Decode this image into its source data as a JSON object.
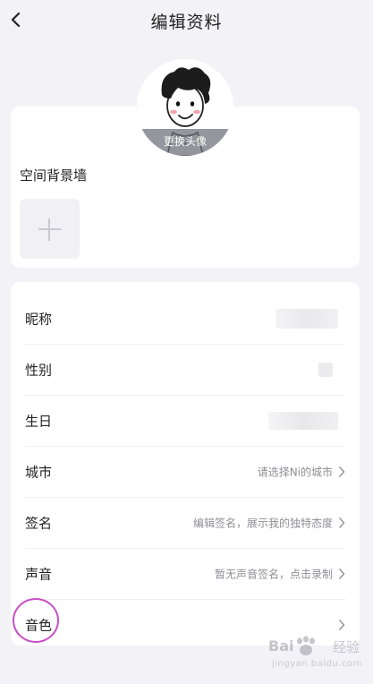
{
  "header": {
    "title": "编辑资料"
  },
  "avatar": {
    "change_label": "更换头像"
  },
  "background": {
    "title": "空间背景墙"
  },
  "profile_rows": [
    {
      "label": "昵称",
      "value": ""
    },
    {
      "label": "性别",
      "value": ""
    },
    {
      "label": "生日",
      "value": ""
    },
    {
      "label": "城市",
      "value": "请选择Ni的城市"
    },
    {
      "label": "签名",
      "value": "编辑签名，展示我的独特态度"
    },
    {
      "label": "声音",
      "value": "暂无声音签名，点击录制"
    },
    {
      "label": "音色",
      "value": ""
    }
  ],
  "watermark": {
    "brand": "Bai",
    "cn": "经验",
    "url": "jingyan.baidu.com"
  },
  "colors": {
    "highlight": "#c94fc4",
    "page_bg": "#f3f2f7"
  }
}
